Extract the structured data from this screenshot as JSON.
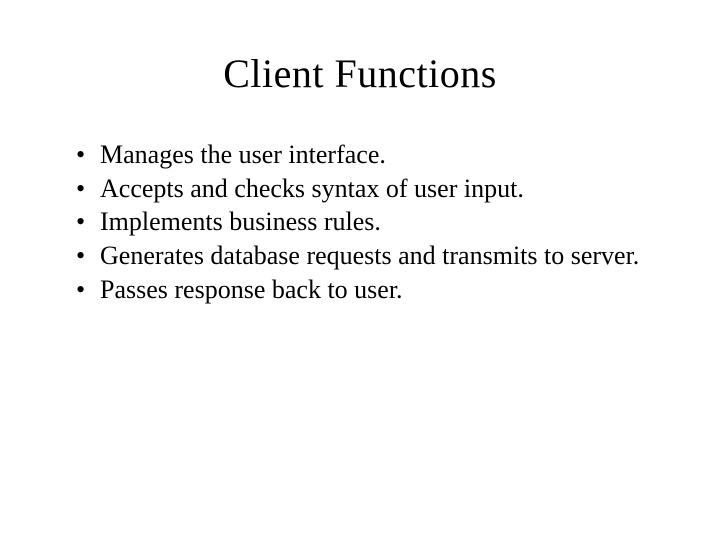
{
  "slide": {
    "title": "Client Functions",
    "bullets": [
      "Manages the user interface.",
      "Accepts and checks syntax of user input.",
      "Implements business rules.",
      "Generates database requests and transmits to server.",
      "Passes response back to user."
    ]
  }
}
